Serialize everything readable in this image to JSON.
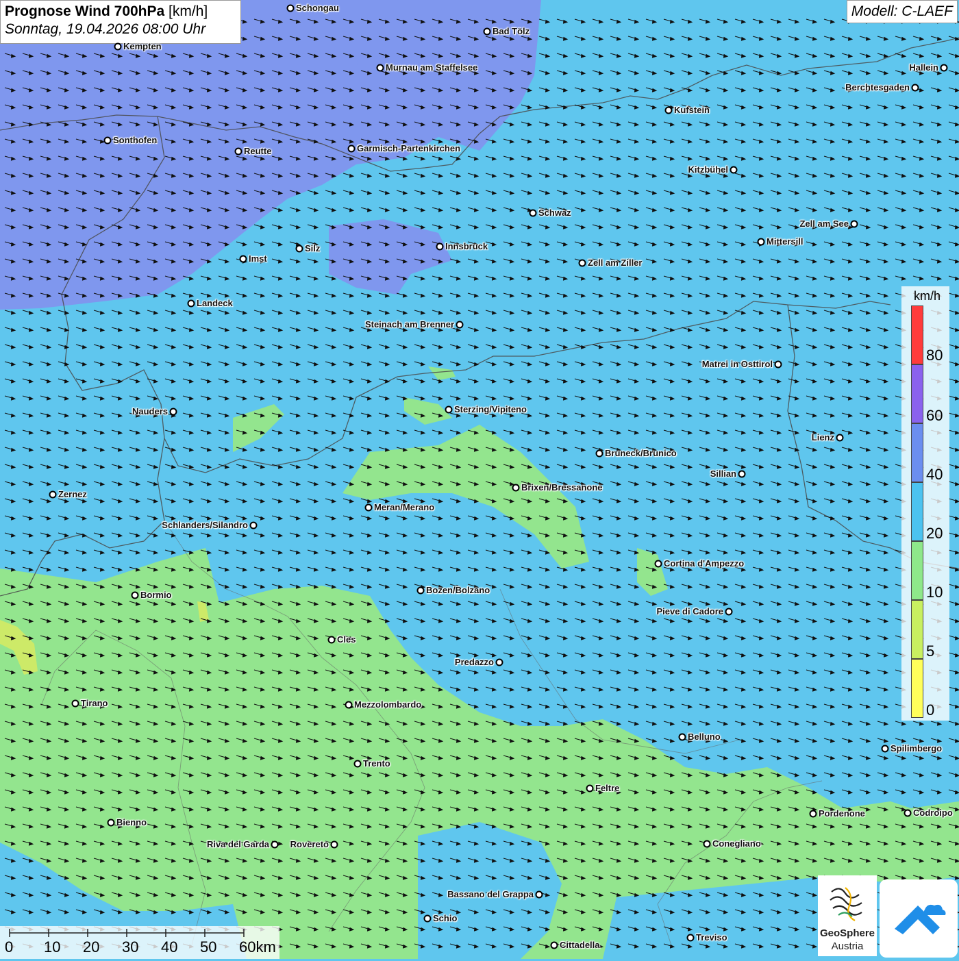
{
  "header": {
    "title_bold": "Prognose Wind 700hPa",
    "title_unit": "[km/h]",
    "subtitle": "Sonntag, 19.04.2026 08:00 Uhr",
    "model": "Modell: C-LAEF"
  },
  "colors": {
    "calm": "#ffff5a",
    "c5": "#c8f060",
    "c10": "#8ee88a",
    "c20": "#4cc3f0",
    "c40": "#6b8ef0",
    "c60": "#8a62ee",
    "c80": "#ff3b3b",
    "arrow": "#111111",
    "border": "#555555"
  },
  "legend": {
    "unit": "km/h",
    "labels": [
      "80",
      "60",
      "40",
      "20",
      "10",
      "5",
      "0"
    ]
  },
  "scalebar": {
    "labels": [
      "0",
      "10",
      "20",
      "30",
      "40",
      "50",
      "60km"
    ]
  },
  "cities": [
    {
      "name": "Schongau",
      "label": "Schongau"
    },
    {
      "name": "Bad Tölz",
      "label": "Bad Tölz"
    },
    {
      "name": "Kempten",
      "label": "Kempten"
    },
    {
      "name": "Murnau",
      "label": "Murnau am Staffelsee"
    },
    {
      "name": "Hallein",
      "label": "Hallein"
    },
    {
      "name": "Berchtesgaden",
      "label": "Berchtesgaden"
    },
    {
      "name": "Kufstein",
      "label": "Kufstein"
    },
    {
      "name": "Sonthofen",
      "label": "Sonthofen"
    },
    {
      "name": "Reutte",
      "label": "Reutte"
    },
    {
      "name": "Garmisch",
      "label": "Garmisch-Partenkirchen"
    },
    {
      "name": "Kitzbühel",
      "label": "Kitzbühel"
    },
    {
      "name": "Schwaz",
      "label": "Schwaz"
    },
    {
      "name": "Zell am See",
      "label": "Zell am See"
    },
    {
      "name": "Mittersill",
      "label": "Mittersill"
    },
    {
      "name": "Silz",
      "label": "Silz"
    },
    {
      "name": "Innsbruck",
      "label": "Innsbruck"
    },
    {
      "name": "Imst",
      "label": "Imst"
    },
    {
      "name": "Zell am Ziller",
      "label": "Zell am Ziller"
    },
    {
      "name": "Landeck",
      "label": "Landeck"
    },
    {
      "name": "Steinach",
      "label": "Steinach am Brenner"
    },
    {
      "name": "Matrei",
      "label": "Matrei in Osttirol"
    },
    {
      "name": "Nauders",
      "label": "Nauders"
    },
    {
      "name": "Sterzing",
      "label": "Sterzing/Vipiteno"
    },
    {
      "name": "Lienz",
      "label": "Lienz"
    },
    {
      "name": "Bruneck",
      "label": "Bruneck/Brunico"
    },
    {
      "name": "Sillian",
      "label": "Sillian"
    },
    {
      "name": "Brixen",
      "label": "Brixen/Bressanone"
    },
    {
      "name": "Zernez",
      "label": "Zernez"
    },
    {
      "name": "Meran",
      "label": "Meran/Merano"
    },
    {
      "name": "Schlanders",
      "label": "Schlanders/Silandro"
    },
    {
      "name": "Cortina",
      "label": "Cortina d'Ampezzo"
    },
    {
      "name": "Bozen",
      "label": "Bozen/Bolzano"
    },
    {
      "name": "Bormio",
      "label": "Bormio"
    },
    {
      "name": "Pieve",
      "label": "Pieve di Cadore"
    },
    {
      "name": "Cles",
      "label": "Cles"
    },
    {
      "name": "Predazzo",
      "label": "Predazzo"
    },
    {
      "name": "Tirano",
      "label": "Tirano"
    },
    {
      "name": "Mezzolombardo",
      "label": "Mezzolombardo"
    },
    {
      "name": "Belluno",
      "label": "Belluno"
    },
    {
      "name": "Spilimbergo",
      "label": "Spilimbergo"
    },
    {
      "name": "Trento",
      "label": "Trento"
    },
    {
      "name": "Feltre",
      "label": "Feltre"
    },
    {
      "name": "Pordenone",
      "label": "Pordenone"
    },
    {
      "name": "Codroipo",
      "label": "Codroipo"
    },
    {
      "name": "Bienno",
      "label": "Bienno"
    },
    {
      "name": "Riva",
      "label": "Riva del Garda"
    },
    {
      "name": "Rovereto",
      "label": "Rovereto"
    },
    {
      "name": "Conegliano",
      "label": "Conegliano"
    },
    {
      "name": "Bassano",
      "label": "Bassano del Grappa"
    },
    {
      "name": "Schio",
      "label": "Schio"
    },
    {
      "name": "Treviso",
      "label": "Treviso"
    },
    {
      "name": "Cittadella",
      "label": "Cittadella"
    }
  ],
  "logos": {
    "geosphere_line1": "GeoSphere",
    "geosphere_line2": "Austria"
  }
}
